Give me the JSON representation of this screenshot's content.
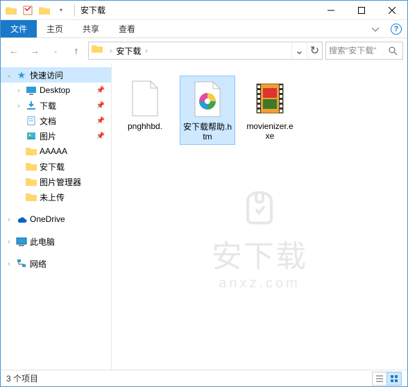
{
  "window": {
    "title": "安下载",
    "minimize_tooltip": "最小化",
    "maximize_tooltip": "最大化",
    "close_tooltip": "关闭"
  },
  "ribbon": {
    "file": "文件",
    "tabs": [
      "主页",
      "共享",
      "查看"
    ],
    "help_tooltip": "帮助"
  },
  "nav": {
    "back_tooltip": "返回",
    "forward_tooltip": "前进",
    "up_tooltip": "上移"
  },
  "address": {
    "crumbs": [
      "安下载"
    ],
    "refresh_tooltip": "刷新"
  },
  "search": {
    "placeholder": "搜索\"安下载\"",
    "button_tooltip": "搜索"
  },
  "tree": {
    "quick_access": "快速访问",
    "items": [
      {
        "label": "Desktop",
        "icon": "desktop",
        "pinned": true
      },
      {
        "label": "下载",
        "icon": "downloads",
        "pinned": true
      },
      {
        "label": "文档",
        "icon": "documents",
        "pinned": true
      },
      {
        "label": "图片",
        "icon": "pictures",
        "pinned": true
      },
      {
        "label": "AAAAA",
        "icon": "folder",
        "pinned": false
      },
      {
        "label": "安下载",
        "icon": "folder",
        "pinned": false
      },
      {
        "label": "图片管理器",
        "icon": "folder",
        "pinned": false
      },
      {
        "label": "未上传",
        "icon": "folder",
        "pinned": false
      }
    ],
    "onedrive": "OneDrive",
    "this_pc": "此电脑",
    "network": "网络"
  },
  "files": [
    {
      "name": "pnghhbd.",
      "icon": "blank",
      "selected": false
    },
    {
      "name": "安下载帮助.htm",
      "icon": "htm",
      "selected": true
    },
    {
      "name": "movienizer.exe",
      "icon": "movienizer",
      "selected": false
    }
  ],
  "status": {
    "text": "3 个项目"
  },
  "watermark": {
    "main": "安下载",
    "sub": "anxz.com"
  },
  "colors": {
    "accent": "#1979ca",
    "selection": "#cde8ff"
  }
}
